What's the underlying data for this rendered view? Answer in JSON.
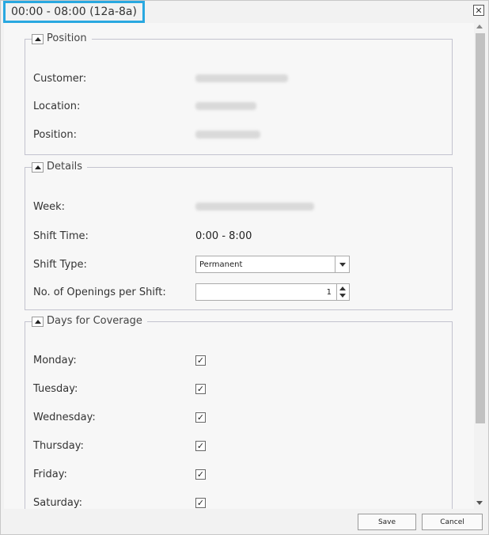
{
  "window": {
    "title": "00:00 - 08:00 (12a-8a)",
    "close_glyph": "✕",
    "accent_color": "#29a8e0"
  },
  "position_section": {
    "legend": "Position",
    "customer_label": "Customer:",
    "location_label": "Location:",
    "position_label": "Position:"
  },
  "details_section": {
    "legend": "Details",
    "week_label": "Week:",
    "shift_time_label": "Shift Time:",
    "shift_time_value": "0:00 - 8:00",
    "shift_type_label": "Shift Type:",
    "shift_type_value": "Permanent",
    "openings_label": "No. of Openings per Shift:",
    "openings_value": "1"
  },
  "coverage_section": {
    "legend": "Days for Coverage",
    "days": [
      {
        "label": "Monday:",
        "checked": true
      },
      {
        "label": "Tuesday:",
        "checked": true
      },
      {
        "label": "Wednesday:",
        "checked": true
      },
      {
        "label": "Thursday:",
        "checked": true
      },
      {
        "label": "Friday:",
        "checked": true
      },
      {
        "label": "Saturday:",
        "checked": true
      }
    ],
    "check_glyph": "✓"
  },
  "footer": {
    "save_label": "Save",
    "cancel_label": "Cancel"
  }
}
